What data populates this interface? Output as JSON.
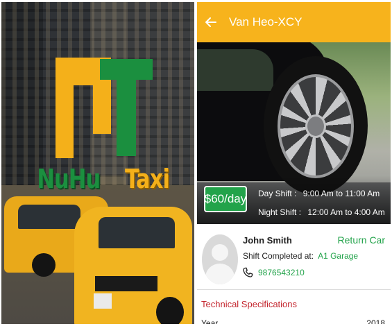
{
  "splash": {
    "brand_word_1": "NuHu",
    "brand_word_2": "Taxi",
    "logo_colors": {
      "n": "#f4b01a",
      "t": "#1b8f3f"
    }
  },
  "appbar": {
    "title": "Van Heo-XCY",
    "back_icon": "arrow-left-icon",
    "background": "#f7b31c"
  },
  "vehicle": {
    "price": "$60/day",
    "day_shift_label": "Day Shift :",
    "day_shift_time": "9:00 Am to 11:00 Am",
    "night_shift_label": "Night Shift :",
    "night_shift_time": "12:00 Am to 4:00 Am"
  },
  "driver": {
    "name": "John Smith",
    "shift_completed_label": "Shift Completed at:",
    "shift_completed_location": "A1 Garage",
    "phone_icon": "phone-icon",
    "phone": "9876543210",
    "return_action": "Return Car"
  },
  "specs": {
    "title": "Technical Specifications",
    "rows": [
      {
        "label": "Year",
        "value": "2018"
      }
    ]
  },
  "colors": {
    "accent_green": "#22a34a",
    "accent_yellow": "#f7b31c",
    "spec_title_red": "#c4262e"
  }
}
